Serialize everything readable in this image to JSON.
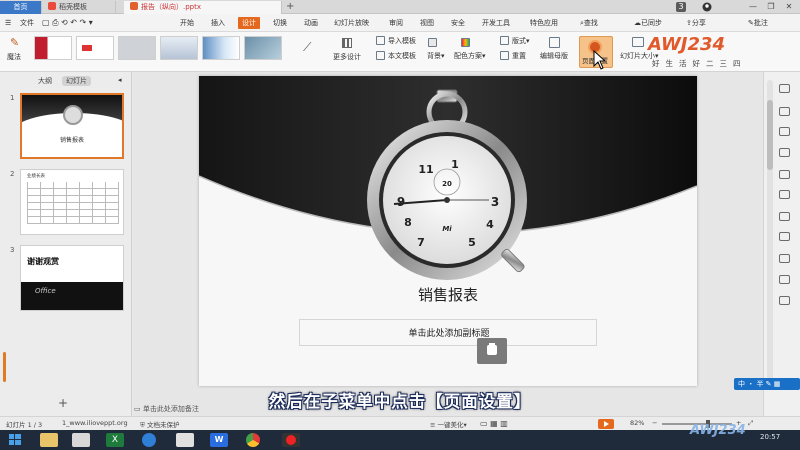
{
  "tabs": {
    "home": "首页",
    "template": "稻壳模板",
    "document": "报告（纵向）.pptx",
    "new_tab": "+"
  },
  "window": {
    "badge": "3",
    "minimize": "—",
    "restore": "❐",
    "close": "✕"
  },
  "menu": {
    "file": "文件",
    "items": [
      "开始",
      "插入",
      "设计",
      "切换",
      "动画",
      "幻灯片放映",
      "审阅",
      "视图",
      "安全",
      "开发工具",
      "特色应用"
    ],
    "active": "设计",
    "search": "查找",
    "sync": "已同步",
    "share": "分享",
    "annotate": "批注"
  },
  "ribbon": {
    "magic": "魔法",
    "more_design": "更多设计",
    "import_template": "导入模板",
    "text_template": "本文模板",
    "background": "背景",
    "color_scheme": "配色方案",
    "layout": "版式",
    "reset": "重置",
    "edit_master": "编辑母版",
    "page_setup": "页面设置",
    "slide_size": "幻灯片大小"
  },
  "left_panel": {
    "tab_outline": "大纲",
    "tab_slides": "幻灯片",
    "slide1_title": "销售报表",
    "slide2_title": "业绩长表",
    "slide3_title": "谢谢观赏",
    "slide3_brand": "Office",
    "add_slide": "+"
  },
  "slide": {
    "title": "销售报表",
    "subtitle_placeholder": "单击此处添加副标题",
    "notes_placeholder": "单击此处添加备注"
  },
  "caption": "然后在子菜单中点击【页面设置】",
  "status": {
    "slide_count": "幻灯片 1 / 3",
    "template_name": "1_www.ilioveppt.org",
    "doc_protect": "文档未保护",
    "beautify": "一键美化",
    "zoom": "82%",
    "ime": "中",
    "ime_mode": "半"
  },
  "taskbar": {
    "time": "20:57"
  },
  "watermark": {
    "logo": "AWJ234",
    "slogan": "好生活好二三四"
  },
  "colors": {
    "accent": "#e4681d",
    "home_tab": "#3b78c8",
    "taskbar": "#1f2a3a"
  }
}
